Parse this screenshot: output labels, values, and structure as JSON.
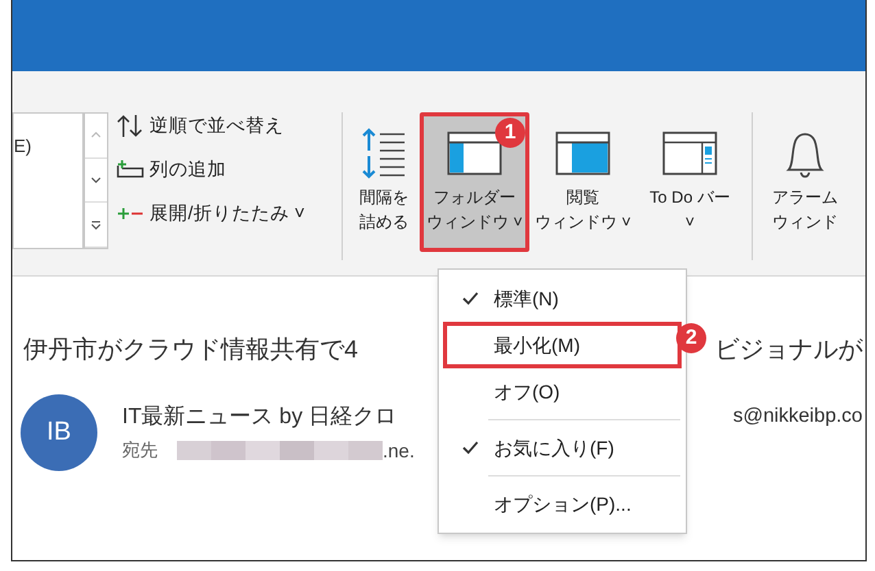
{
  "ribbon": {
    "list_box": {
      "text": "E)"
    },
    "commands": [
      {
        "kind": "sort",
        "label": "逆順で並べ替え"
      },
      {
        "kind": "add-column",
        "label": "列の追加"
      },
      {
        "kind": "expand",
        "label": "展開/折りたたみ ˅"
      }
    ],
    "buttons": [
      {
        "kind": "spacing",
        "lines": [
          "間隔を",
          "詰める"
        ],
        "selected": false
      },
      {
        "kind": "folder-pane",
        "lines": [
          "フォルダー",
          "ウィンドウ ˅"
        ],
        "selected": true
      },
      {
        "kind": "reading-pane",
        "lines": [
          "閲覧",
          "ウィンドウ ˅"
        ],
        "selected": false
      },
      {
        "kind": "todo",
        "lines": [
          "To Do バー",
          "˅"
        ],
        "selected": false
      },
      {
        "kind": "alarm",
        "lines": [
          "アラーム",
          "ウィンド"
        ],
        "selected": false
      }
    ]
  },
  "callouts": [
    "1",
    "2"
  ],
  "menu": {
    "items": [
      {
        "label": "標準(N)",
        "checked": true,
        "highlighted": false
      },
      {
        "label": "最小化(M)",
        "checked": false,
        "highlighted": true
      },
      {
        "label": "オフ(O)",
        "checked": false,
        "highlighted": false
      },
      {
        "label": "お気に入り(F)",
        "checked": true,
        "highlighted": false,
        "divider_before": true
      },
      {
        "label": "オプション(P)...",
        "checked": false,
        "highlighted": false,
        "divider_before": true
      }
    ]
  },
  "message": {
    "subject_left": "伊丹市がクラウド情報共有で4",
    "subject_right": "ビジョナルが",
    "avatar": "IB",
    "sender_left": "IT最新ニュース by 日経クロ",
    "sender_right": "s@nikkeibp.co",
    "to_label": "宛先",
    "to_suffix": ".ne."
  }
}
